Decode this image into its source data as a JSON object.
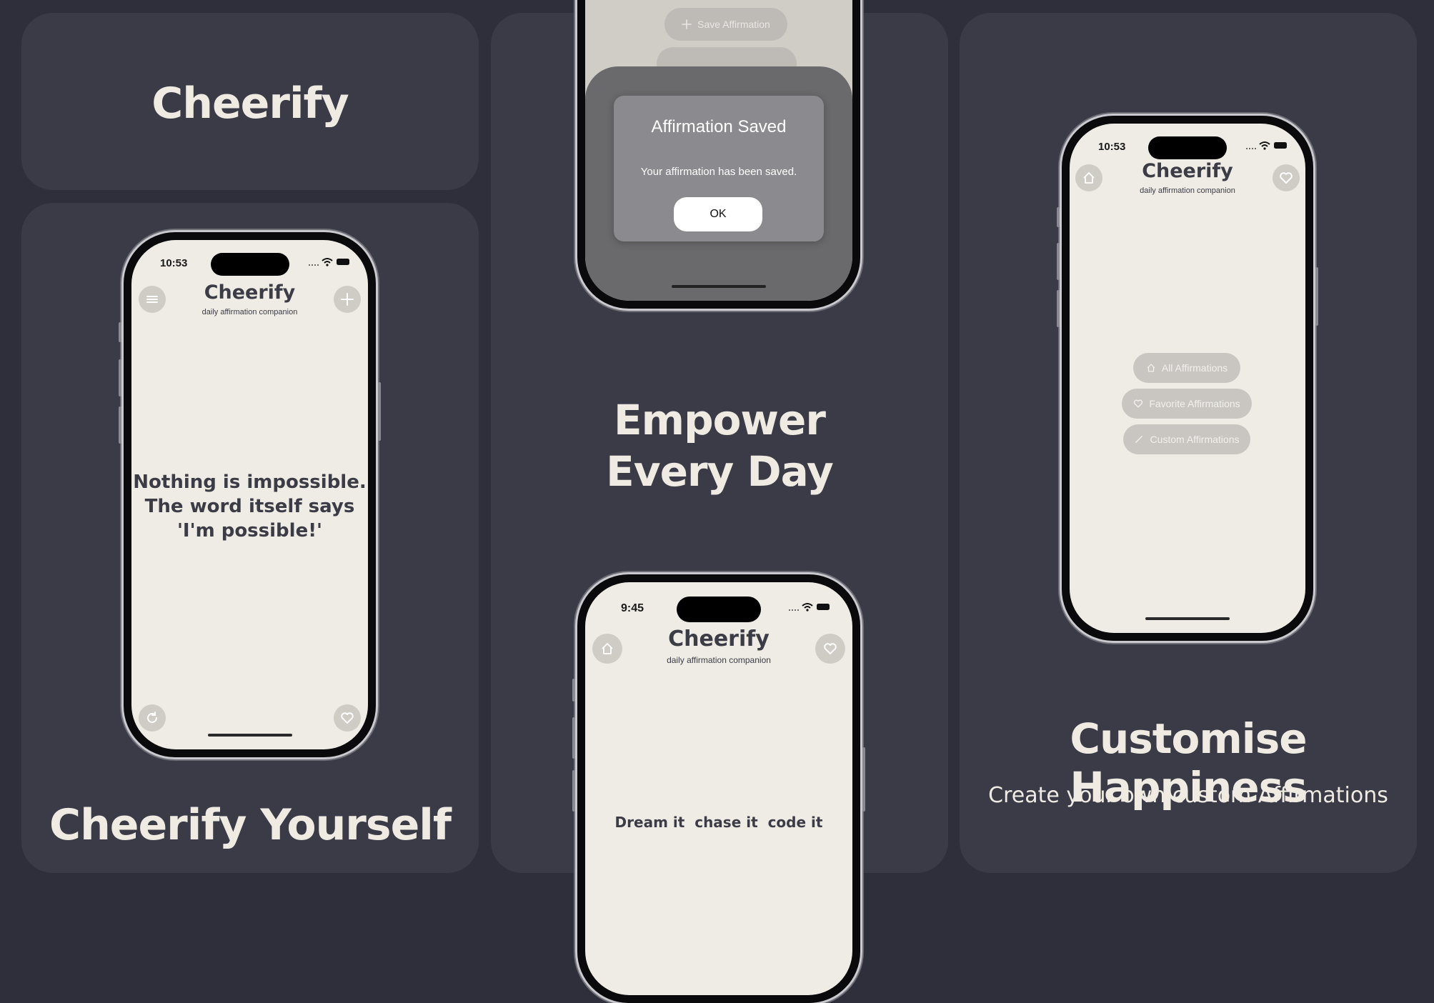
{
  "cards": {
    "title": {
      "text": "Cheerify"
    },
    "left": {
      "headline": "Cheerify Yourself"
    },
    "middle": {
      "headline_line1": "Empower",
      "headline_line2": "Every Day"
    },
    "right": {
      "headline": "Customise Happiness",
      "subheadline": "Create your own custom Affirmations"
    }
  },
  "phone_left": {
    "time": "10:53",
    "app_title": "Cheerify",
    "app_subtitle": "daily affirmation companion",
    "quote_lines": [
      "Nothing is impossible.",
      "The word itself says",
      "'I'm possible!'"
    ],
    "icons": {
      "top_left": "menu-icon",
      "top_right": "plus-icon",
      "bottom_left": "refresh-icon",
      "bottom_right": "heart-icon"
    }
  },
  "phone_mid_top": {
    "save_button": "Save Affirmation",
    "alert": {
      "title": "Affirmation Saved",
      "message": "Your affirmation has been saved.",
      "ok": "OK"
    }
  },
  "phone_mid_bottom": {
    "time": "9:45",
    "app_title": "Cheerify",
    "app_subtitle": "daily affirmation companion",
    "quote": "Dream it  chase it  code it"
  },
  "phone_right": {
    "time": "10:53",
    "app_title": "Cheerify",
    "app_subtitle": "daily affirmation companion",
    "menu": [
      "All Affirmations",
      "Favorite Affirmations",
      "Custom Affirmations"
    ]
  },
  "colors": {
    "background": "#2e2f3a",
    "card": "#3a3b47",
    "headline": "#efebe3",
    "screen": "#efece5"
  }
}
